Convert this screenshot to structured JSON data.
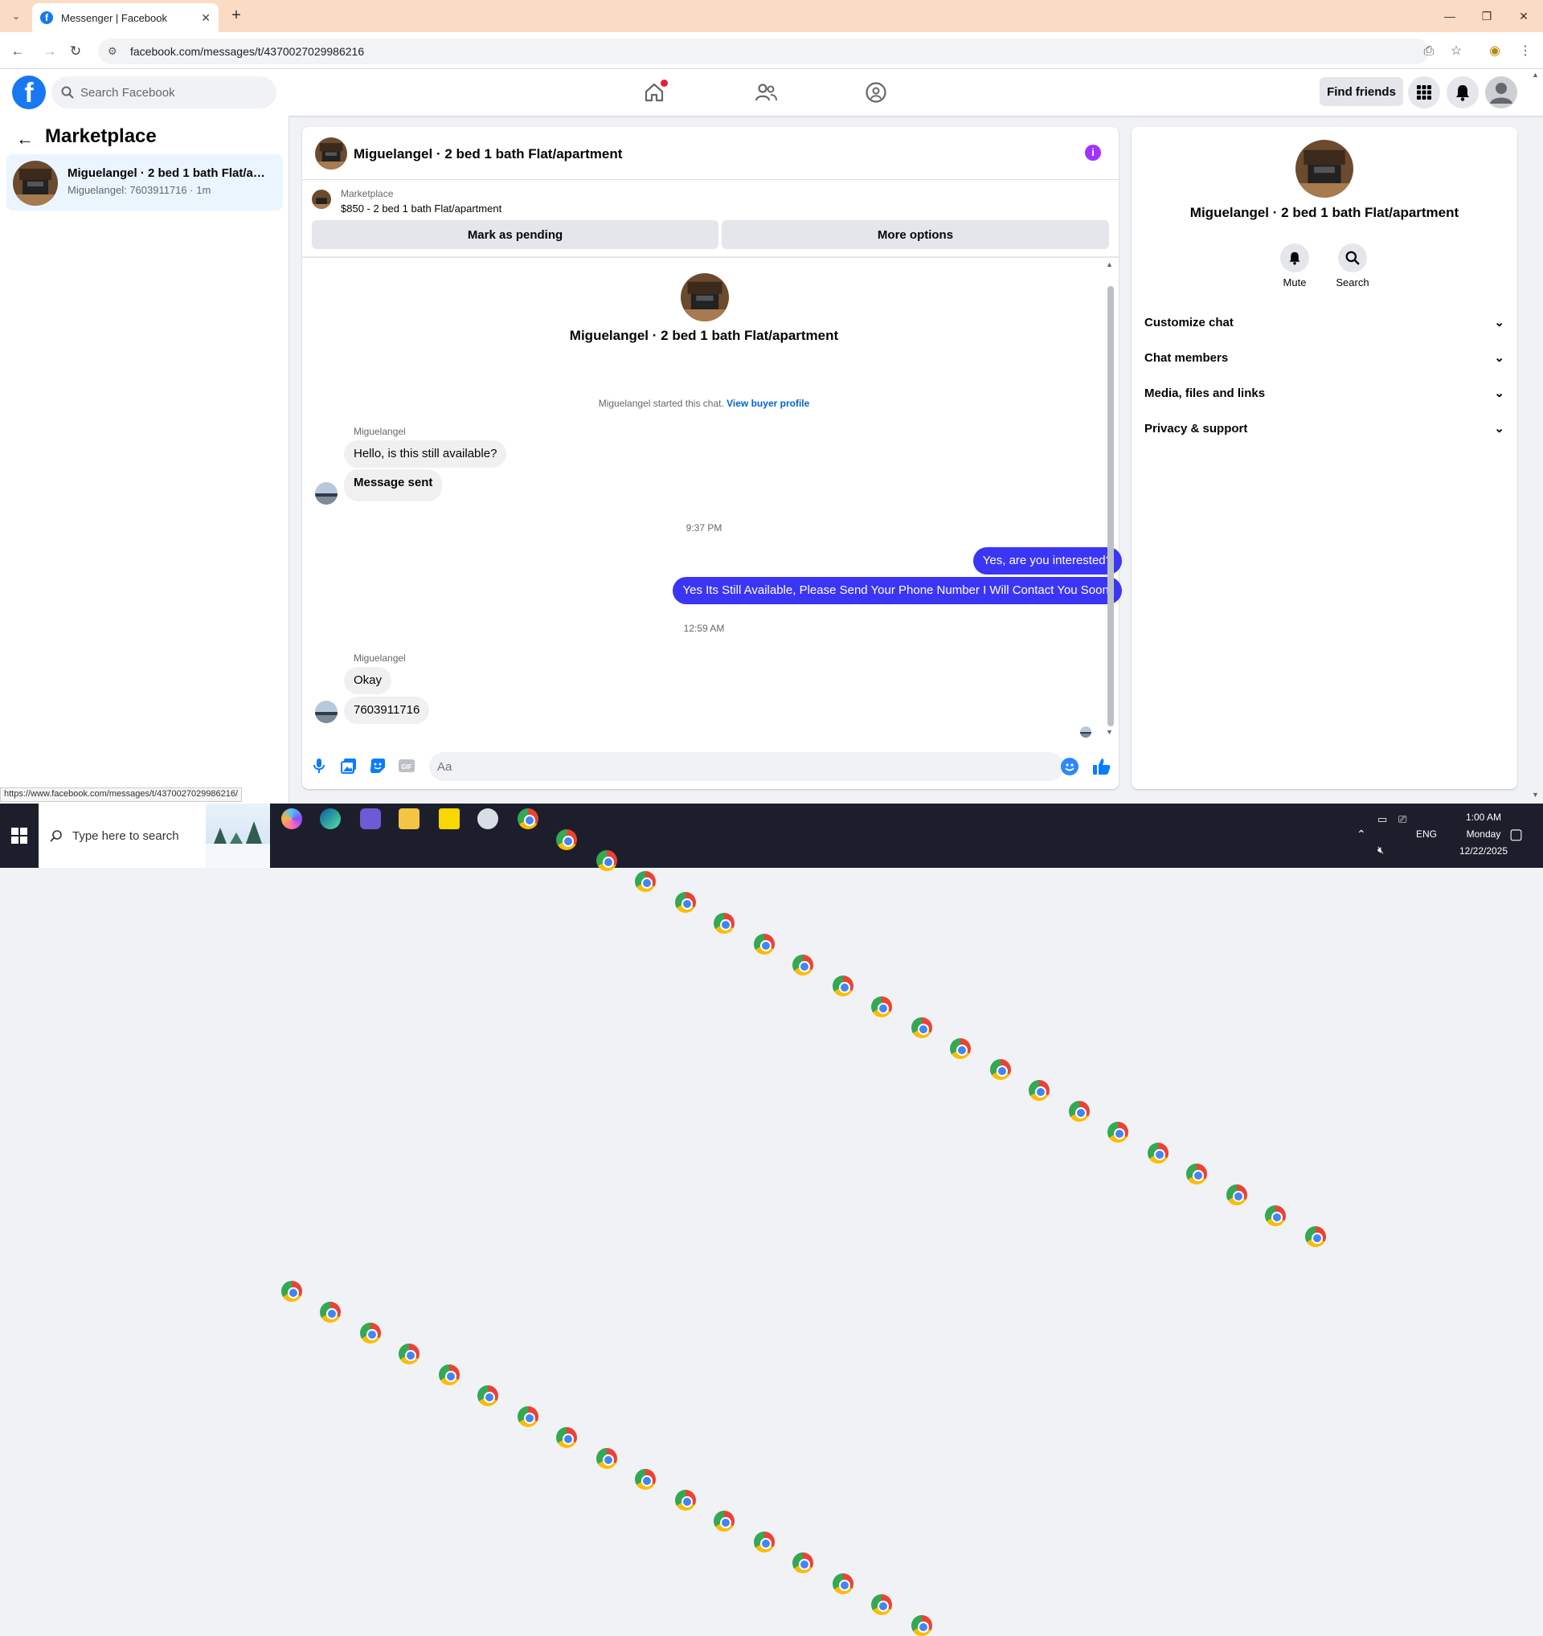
{
  "browser": {
    "tab_title": "Messenger | Facebook",
    "url": "facebook.com/messages/t/4370027029986216",
    "status_url": "https://www.facebook.com/messages/t/4370027029986216/"
  },
  "header": {
    "search_placeholder": "Search Facebook",
    "find_friends_label": "Find friends",
    "brand_color": "#1877f2"
  },
  "sidebar": {
    "title": "Marketplace",
    "conversation": {
      "name": "Miguelangel · 2 bed 1 bath Flat/ap...",
      "subtitle": "Miguelangel: 7603911716 · 1m"
    }
  },
  "chat": {
    "title": "Miguelangel · 2 bed 1 bath Flat/apartment",
    "pinned": {
      "label": "Marketplace",
      "listing": "$850 - 2 bed 1 bath Flat/apartment",
      "mark_pending_label": "Mark as pending",
      "more_options_label": "More options"
    },
    "intro_title": "Miguelangel · 2 bed 1 bath Flat/apartment",
    "started_text": "Miguelangel started this chat.",
    "buyer_profile_link": "View buyer profile",
    "group1": {
      "sender": "Miguelangel",
      "messages": [
        "Hello, is this still available?",
        "Message sent"
      ]
    },
    "timestamp1": "9:37 PM",
    "outgoing": [
      "Yes, are you interested?",
      "Yes Its Still Available, Please Send Your Phone Number I Will Contact You Soon."
    ],
    "timestamp2": "12:59 AM",
    "group2": {
      "sender": "Miguelangel",
      "messages": [
        "Okay",
        "7603911716"
      ]
    },
    "composer_placeholder": "Aa",
    "outgoing_color": "#3b36f5"
  },
  "info_panel": {
    "title": "Miguelangel · 2 bed 1 bath Flat/apartment",
    "actions": [
      {
        "label": "Mute",
        "icon": "bell-icon"
      },
      {
        "label": "Search",
        "icon": "search-icon"
      }
    ],
    "sections": [
      "Customize chat",
      "Chat members",
      "Media, files and links",
      "Privacy & support"
    ]
  },
  "taskbar": {
    "search_placeholder": "Type here to search",
    "language": "ENG",
    "time": "1:00 AM",
    "day": "Monday",
    "date": "12/22/2025"
  }
}
